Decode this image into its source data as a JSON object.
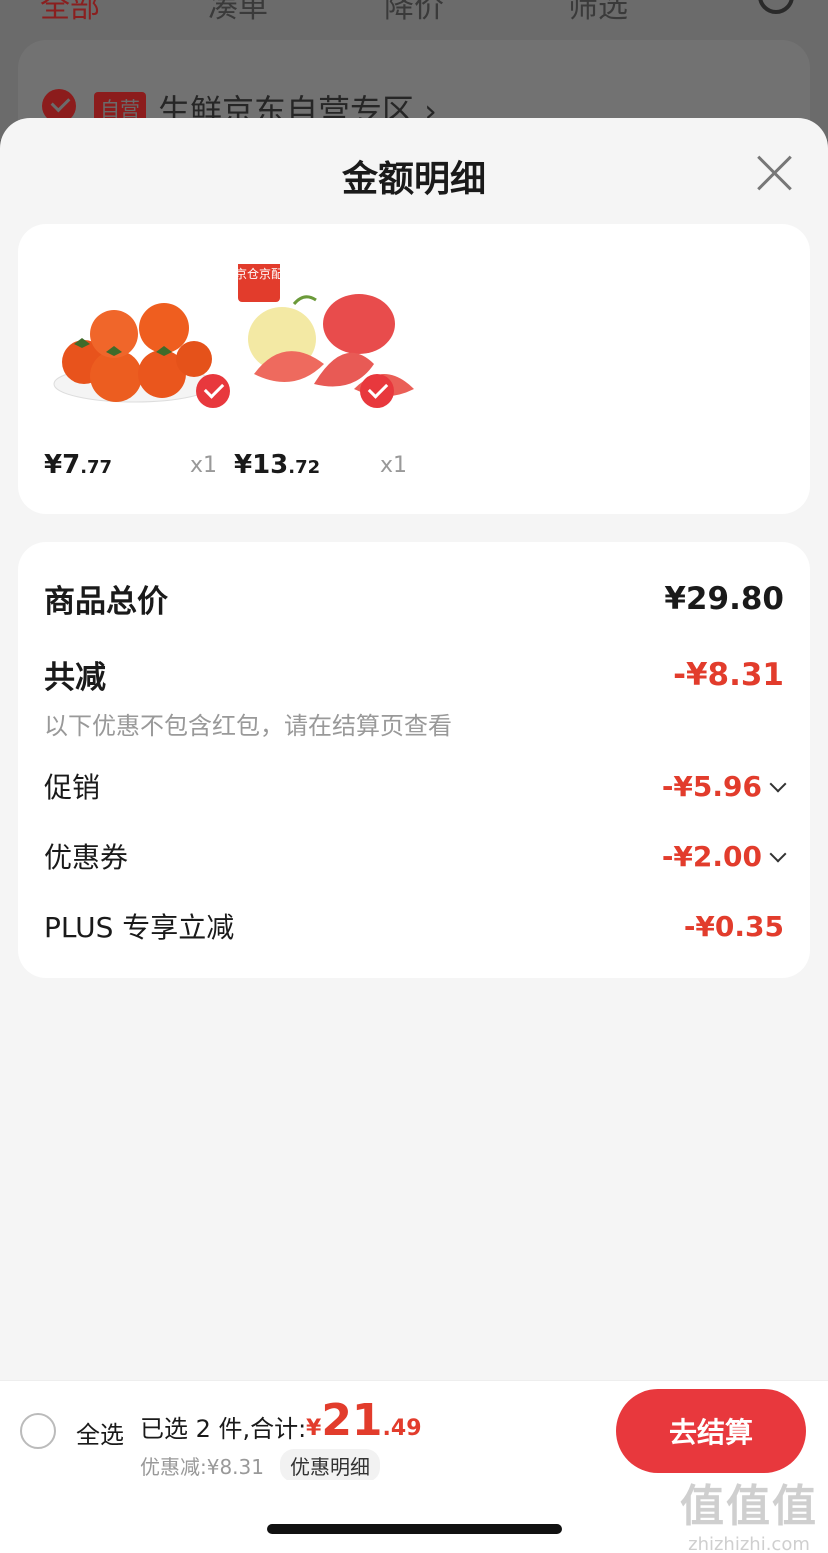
{
  "background": {
    "tabs": [
      "全部",
      "凑单",
      "降价",
      "筛选"
    ],
    "shop_badge": "自营",
    "shop_name": "生鲜京东自营专区 ›"
  },
  "sheet": {
    "title": "金额明细",
    "goods": [
      {
        "name": "柿子",
        "price_int": "¥7",
        "price_dec": ".77",
        "qty": "x1",
        "checked": true
      },
      {
        "name": "红心柚",
        "price_int": "¥13",
        "price_dec": ".72",
        "qty": "x1",
        "checked": true,
        "badge": "京仓京配"
      }
    ],
    "summary": {
      "total_label": "商品总价",
      "total_value": "¥29.80",
      "reduce_label": "共减",
      "reduce_value": "-¥8.31",
      "note": "以下优惠不包含红包，请在结算页查看",
      "promo_label": "促销",
      "promo_value": "-¥5.96",
      "coupon_label": "优惠券",
      "coupon_value": "-¥2.00",
      "plus_label": "PLUS 专享立减",
      "plus_value": "-¥0.35"
    }
  },
  "bottom_bar": {
    "select_all": "全选",
    "selected": "已选 2 件,合计:",
    "total_currency": "¥",
    "total_int": "21",
    "total_dec": ".49",
    "discount": "优惠减:¥8.31",
    "detail_button": "优惠明细",
    "checkout_button": "去结算"
  },
  "watermark": {
    "big": "值值值",
    "small": "zhizhizhi.com"
  },
  "colors": {
    "accent": "#e23c2c",
    "button": "#e8383d",
    "sheet_bg": "#f5f5f5"
  }
}
